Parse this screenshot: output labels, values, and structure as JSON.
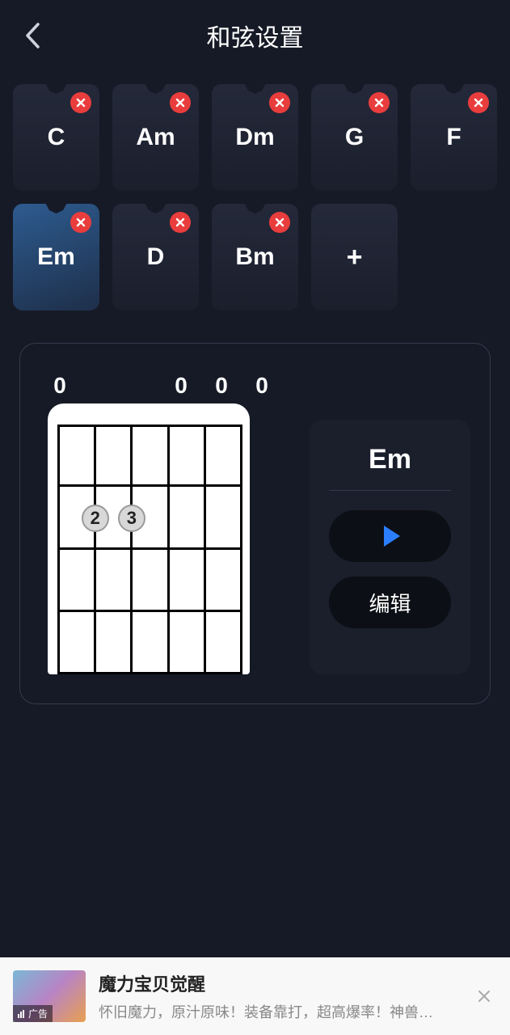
{
  "header": {
    "title": "和弦设置"
  },
  "chords": [
    {
      "label": "C",
      "selected": false
    },
    {
      "label": "Am",
      "selected": false
    },
    {
      "label": "Dm",
      "selected": false
    },
    {
      "label": "G",
      "selected": false
    },
    {
      "label": "F",
      "selected": false
    },
    {
      "label": "Em",
      "selected": true
    },
    {
      "label": "D",
      "selected": false
    },
    {
      "label": "Bm",
      "selected": false
    }
  ],
  "add_label": "+",
  "detail": {
    "chord_name": "Em",
    "open_strings": [
      "0",
      "",
      "",
      "0",
      "0",
      "0"
    ],
    "fingers": [
      {
        "string": 4,
        "fret": 2,
        "label": "2"
      },
      {
        "string": 3,
        "fret": 2,
        "label": "3"
      }
    ],
    "edit_label": "编辑"
  },
  "ad": {
    "title": "魔力宝贝觉醒",
    "desc": "怀旧魔力，原汁原味！装备靠打，超高爆率！神兽…",
    "badge": "广告"
  }
}
